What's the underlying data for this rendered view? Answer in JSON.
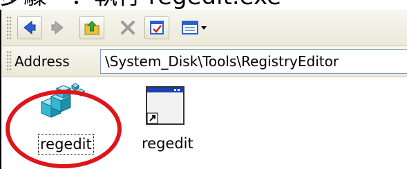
{
  "header_text": "步驟一：執行 regedit.exe",
  "toolbar": {
    "buttons": [
      {
        "icon": "back-arrow-icon"
      },
      {
        "icon": "forward-arrow-icon"
      },
      {
        "icon": "up-folder-icon"
      },
      {
        "icon": "delete-icon"
      },
      {
        "icon": "properties-icon"
      },
      {
        "icon": "views-icon"
      }
    ]
  },
  "address": {
    "label": "Address",
    "value": "\\System_Disk\\Tools\\RegistryEditor"
  },
  "files": [
    {
      "name": "regedit",
      "icon": "registry-editor-icon",
      "selected": true
    },
    {
      "name": "regedit",
      "icon": "shortcut-window-icon",
      "selected": false
    }
  ],
  "colors": {
    "highlight": "#e0141b",
    "toolbar_bg": "#ece9d8",
    "arrow_blue": "#2a5fd0"
  }
}
